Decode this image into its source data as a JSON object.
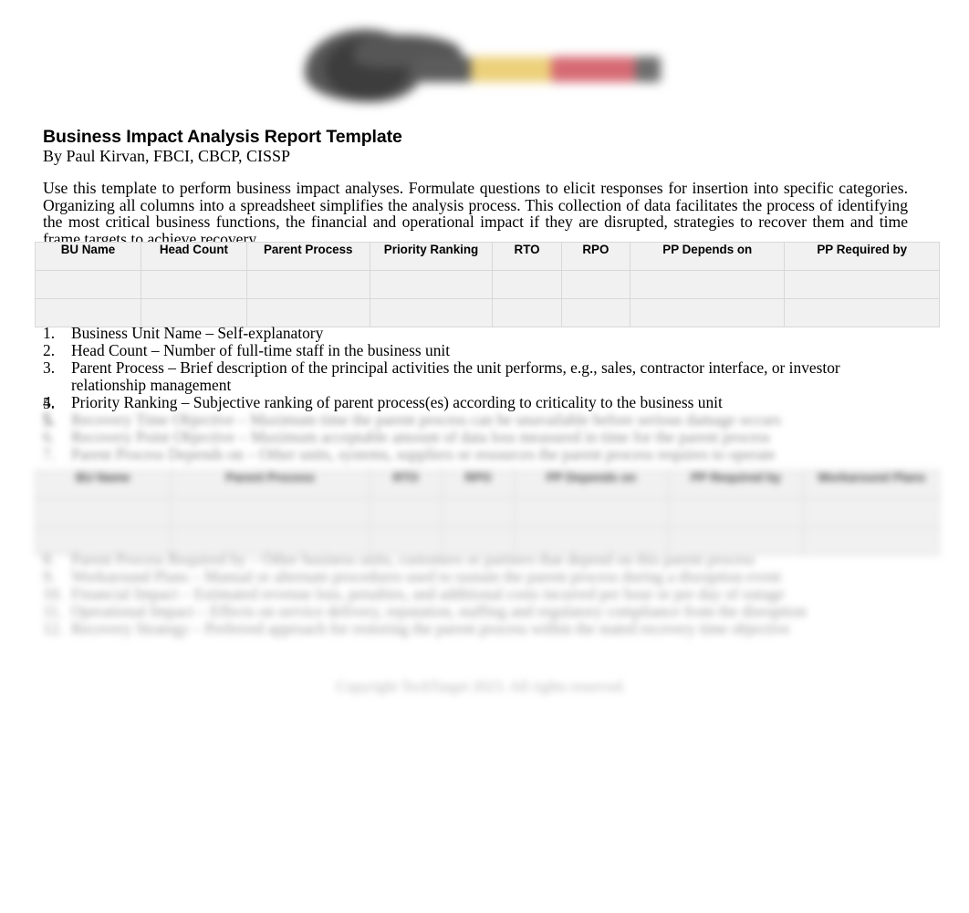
{
  "document": {
    "title": "Business Impact Analysis Report Template",
    "byline": "By Paul Kirvan, FBCI, CBCP, CISSP",
    "intro": "Use this template to perform business impact analyses. Formulate questions to elicit responses for insertion into specific categories. Organizing all columns into a spreadsheet simplifies the analysis process. This collection of data facilitates the process of identifying the most critical business functions, the financial and operational impact if they are disrupted, strategies to recover them and time frame targets to achieve recovery."
  },
  "logo": {
    "name": "site-logo",
    "colors": {
      "mark": "#4a4a4a",
      "word_one": "#5c5c5c",
      "word_two": "#ecd07a",
      "word_three": "#d66a73",
      "word_four": "#6e6e6e"
    }
  },
  "table_one": {
    "name": "bia-data-table",
    "headers": [
      "BU Name",
      "Head Count",
      "Parent Process",
      "Priority Ranking",
      "RTO",
      "RPO",
      "PP Depends on",
      "PP Required by"
    ],
    "column_widths": [
      "11.7%",
      "11.7%",
      "13.6%",
      "13.6%",
      "7.6%",
      "7.6%",
      "17.1%",
      "17.1%"
    ],
    "empty_rows": 2,
    "background": "#f1f1f1"
  },
  "table_two": {
    "name": "bia-data-table-secondary",
    "headers": [
      "BU Name",
      "Parent Process",
      "RTO",
      "RPO",
      "PP Depends on",
      "PP Required by",
      "Workaround Plans"
    ],
    "column_widths": [
      "15%",
      "22%",
      "8%",
      "8%",
      "17%",
      "15%",
      "15%"
    ],
    "empty_rows": 2,
    "background": "#f1f1f1"
  },
  "notes": {
    "items": [
      {
        "number": "1.",
        "text": "Business Unit Name – Self-explanatory",
        "redacted": false
      },
      {
        "number": "2.",
        "text": "Head Count – Number of full-time staff in the business unit",
        "redacted": false
      },
      {
        "number": "3.",
        "text": "Parent Process – Brief description of the principal activities the unit performs, e.g., sales, contractor interface, or investor relationship management",
        "redacted": false
      },
      {
        "number": "4.",
        "text": "Priority Ranking – Subjective ranking of parent process(es) according to criticality to the business unit",
        "redacted": false
      },
      {
        "number": "5.",
        "text": "Recovery Time Objective – Maximum time the parent process can be unavailable before serious damage occurs",
        "redacted": true
      },
      {
        "number": "6.",
        "text": "Recovery Point Objective – Maximum acceptable amount of data loss measured in time for the parent process",
        "redacted": true
      },
      {
        "number": "7.",
        "text": "Parent Process Depends on – Other units, systems, suppliers or resources the parent process requires to operate",
        "redacted": true
      }
    ]
  },
  "lower_notes": {
    "items": [
      {
        "number": "8.",
        "text": "Parent Process Required by – Other business units, customers or partners that depend on this parent process"
      },
      {
        "number": "9.",
        "text": "Workaround Plans – Manual or alternate procedures used to sustain the parent process during a disruption event"
      },
      {
        "number": "10.",
        "text": "Financial Impact – Estimated revenue loss, penalties, and additional costs incurred per hour or per day of outage"
      },
      {
        "number": "11.",
        "text": "Operational Impact – Effects on service delivery, reputation, staffing and regulatory compliance from the disruption"
      },
      {
        "number": "12.",
        "text": "Recovery Strategy – Preferred approach for restoring the parent process within the stated recovery time objective"
      }
    ]
  },
  "footer": {
    "text": "Copyright TechTarget 2023. All rights reserved."
  }
}
